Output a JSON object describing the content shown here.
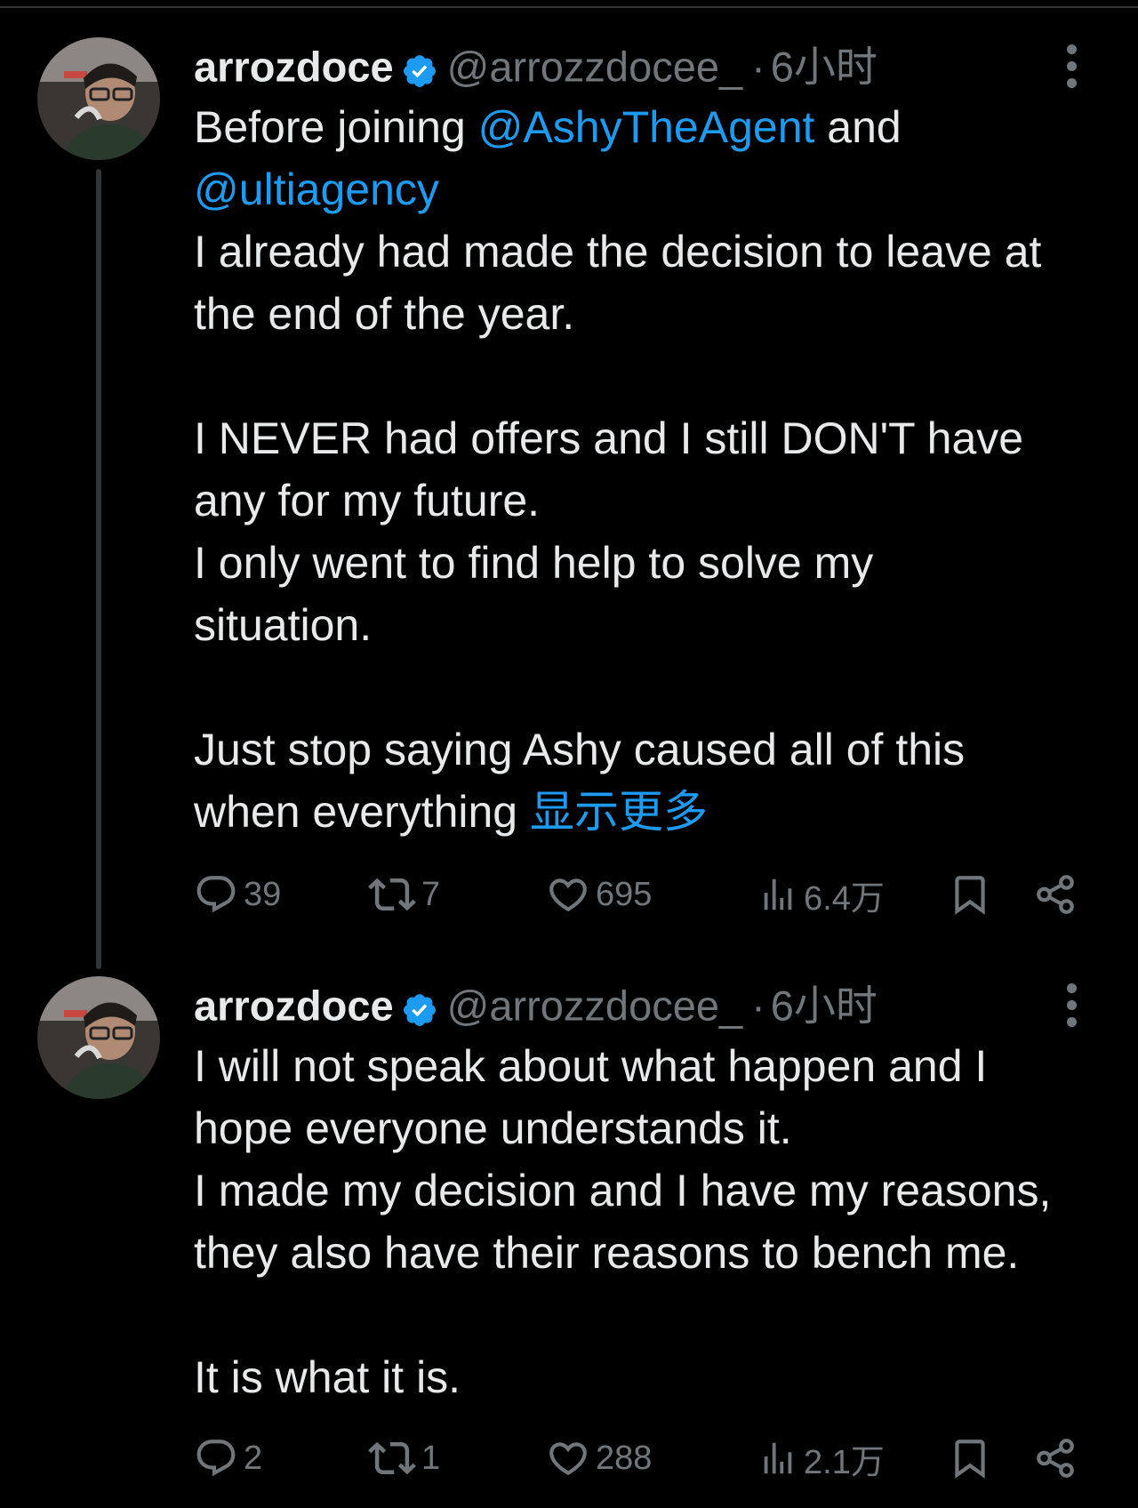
{
  "colors": {
    "background": "#000000",
    "text": "#e7e9ea",
    "muted": "#71767b",
    "link": "#1d9bf0",
    "verified_badge": "#1d9bf0",
    "thread_line": "#333639"
  },
  "tweets": [
    {
      "author": {
        "display_name": "arrozdoce",
        "handle": "@arrozzdocee_",
        "verified": true,
        "avatar_icon": "user-avatar"
      },
      "separator": "·",
      "time": "6小时",
      "body": {
        "l1_pre": "Before joining ",
        "l1_mention": "@AshyTheAgent",
        "l1_post": " and",
        "l2_mention": "@ultiagency",
        "l3": "I already had made the decision to leave at",
        "l4": "the end of the year.",
        "l5": "I NEVER had offers and I still DON'T have",
        "l6": "any for my future.",
        "l7": "I only went to find help to solve my",
        "l8": "situation.",
        "l9": "Just stop saying Ashy caused all of this",
        "l10_pre": "when everything ",
        "show_more": "显示更多"
      },
      "actions": {
        "replies": "39",
        "reposts": "7",
        "likes": "695",
        "views": "6.4万"
      }
    },
    {
      "author": {
        "display_name": "arrozdoce",
        "handle": "@arrozzdocee_",
        "verified": true,
        "avatar_icon": "user-avatar"
      },
      "separator": "·",
      "time": "6小时",
      "body": {
        "l1": "I will not speak about what happen and I",
        "l2": "hope everyone understands it.",
        "l3": "I made my decision and I have my reasons,",
        "l4": "they also have their reasons to bench me.",
        "l5": "It is what it is."
      },
      "actions": {
        "replies": "2",
        "reposts": "1",
        "likes": "288",
        "views": "2.1万"
      }
    }
  ]
}
